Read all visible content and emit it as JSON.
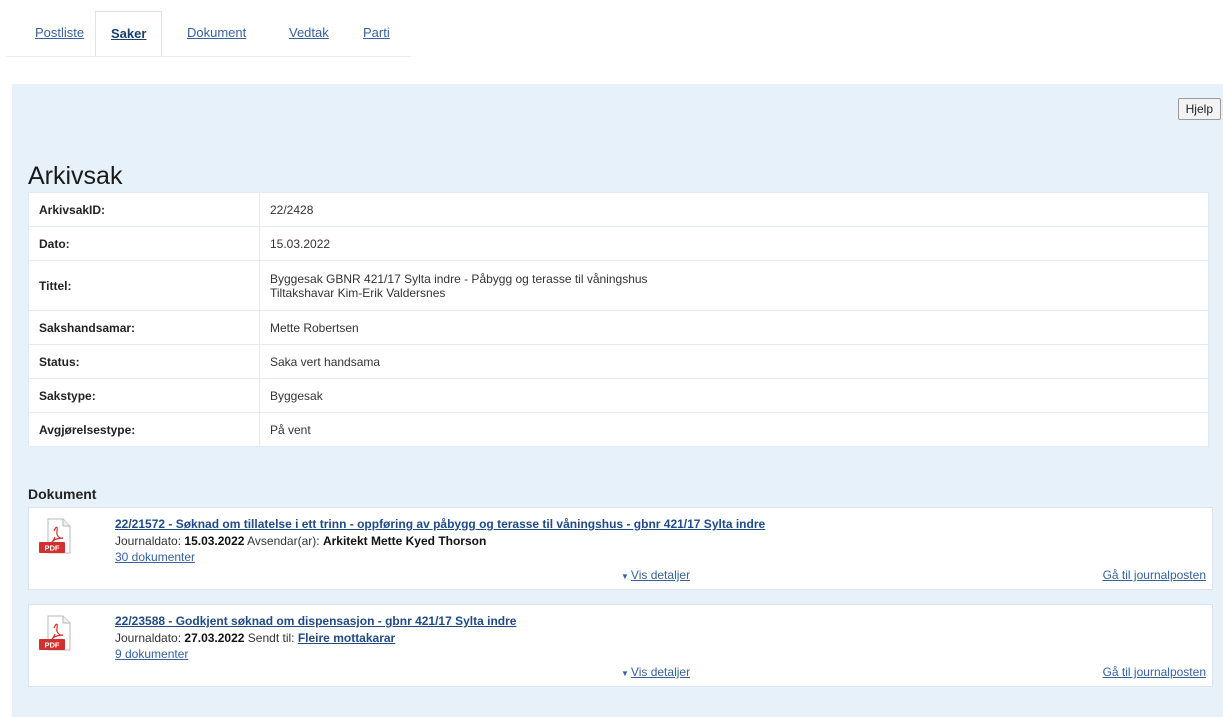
{
  "tabs": [
    {
      "label": "Postliste",
      "active": false
    },
    {
      "label": "Saker",
      "active": true
    },
    {
      "label": "Dokument",
      "active": false
    },
    {
      "label": "Vedtak",
      "active": false
    },
    {
      "label": "Parti",
      "active": false
    }
  ],
  "help_label": "Hjelp",
  "page_title": "Arkivsak",
  "info": {
    "arkivsakid": {
      "label": "ArkivsakID:",
      "value": "22/2428"
    },
    "dato": {
      "label": "Dato:",
      "value": "15.03.2022"
    },
    "tittel": {
      "label": "Tittel:",
      "value_line1": "Byggesak GBNR 421/17 Sylta indre - Påbygg og terasse til våningshus",
      "value_line2": "Tiltakshavar Kim-Erik Valdersnes"
    },
    "sakshandsamar": {
      "label": "Sakshandsamar:",
      "value": "Mette Robertsen"
    },
    "status": {
      "label": "Status:",
      "value": "Saka vert handsama"
    },
    "sakstype": {
      "label": "Sakstype:",
      "value": "Byggesak"
    },
    "avgjorelsestype": {
      "label": "Avgjørelsestype:",
      "value": "På vent"
    }
  },
  "documents_heading": "Dokument",
  "documents": [
    {
      "title": "22/21572 - Søknad om tillatelse i ett trinn - oppføring av påbygg og terasse til våningshus - gbnr 421/17 Sylta indre",
      "journaldato_label": "Journaldato:",
      "journaldato": "15.03.2022",
      "party_label": "Avsendar(ar):",
      "party": "Arkitekt Mette Kyed Thorson",
      "count": "30 dokumenter",
      "details": "Vis detaljer",
      "goto": "Gå til journalposten"
    },
    {
      "title": "22/23588 - Godkjent søknad om dispensasjon - gbnr 421/17 Sylta indre",
      "journaldato_label": "Journaldato:",
      "journaldato": "27.03.2022",
      "party_label": "Sendt til:",
      "party": "Fleire mottakarar",
      "count": "9 dokumenter",
      "details": "Vis detaljer",
      "goto": "Gå til journalposten"
    }
  ],
  "icons": {
    "pdf": "pdf-icon",
    "details_arrow": "triangle-down-icon"
  },
  "colors": {
    "panel_bg": "#e6f1fa",
    "link": "#36619e",
    "pdf_red": "#d32f2f"
  }
}
